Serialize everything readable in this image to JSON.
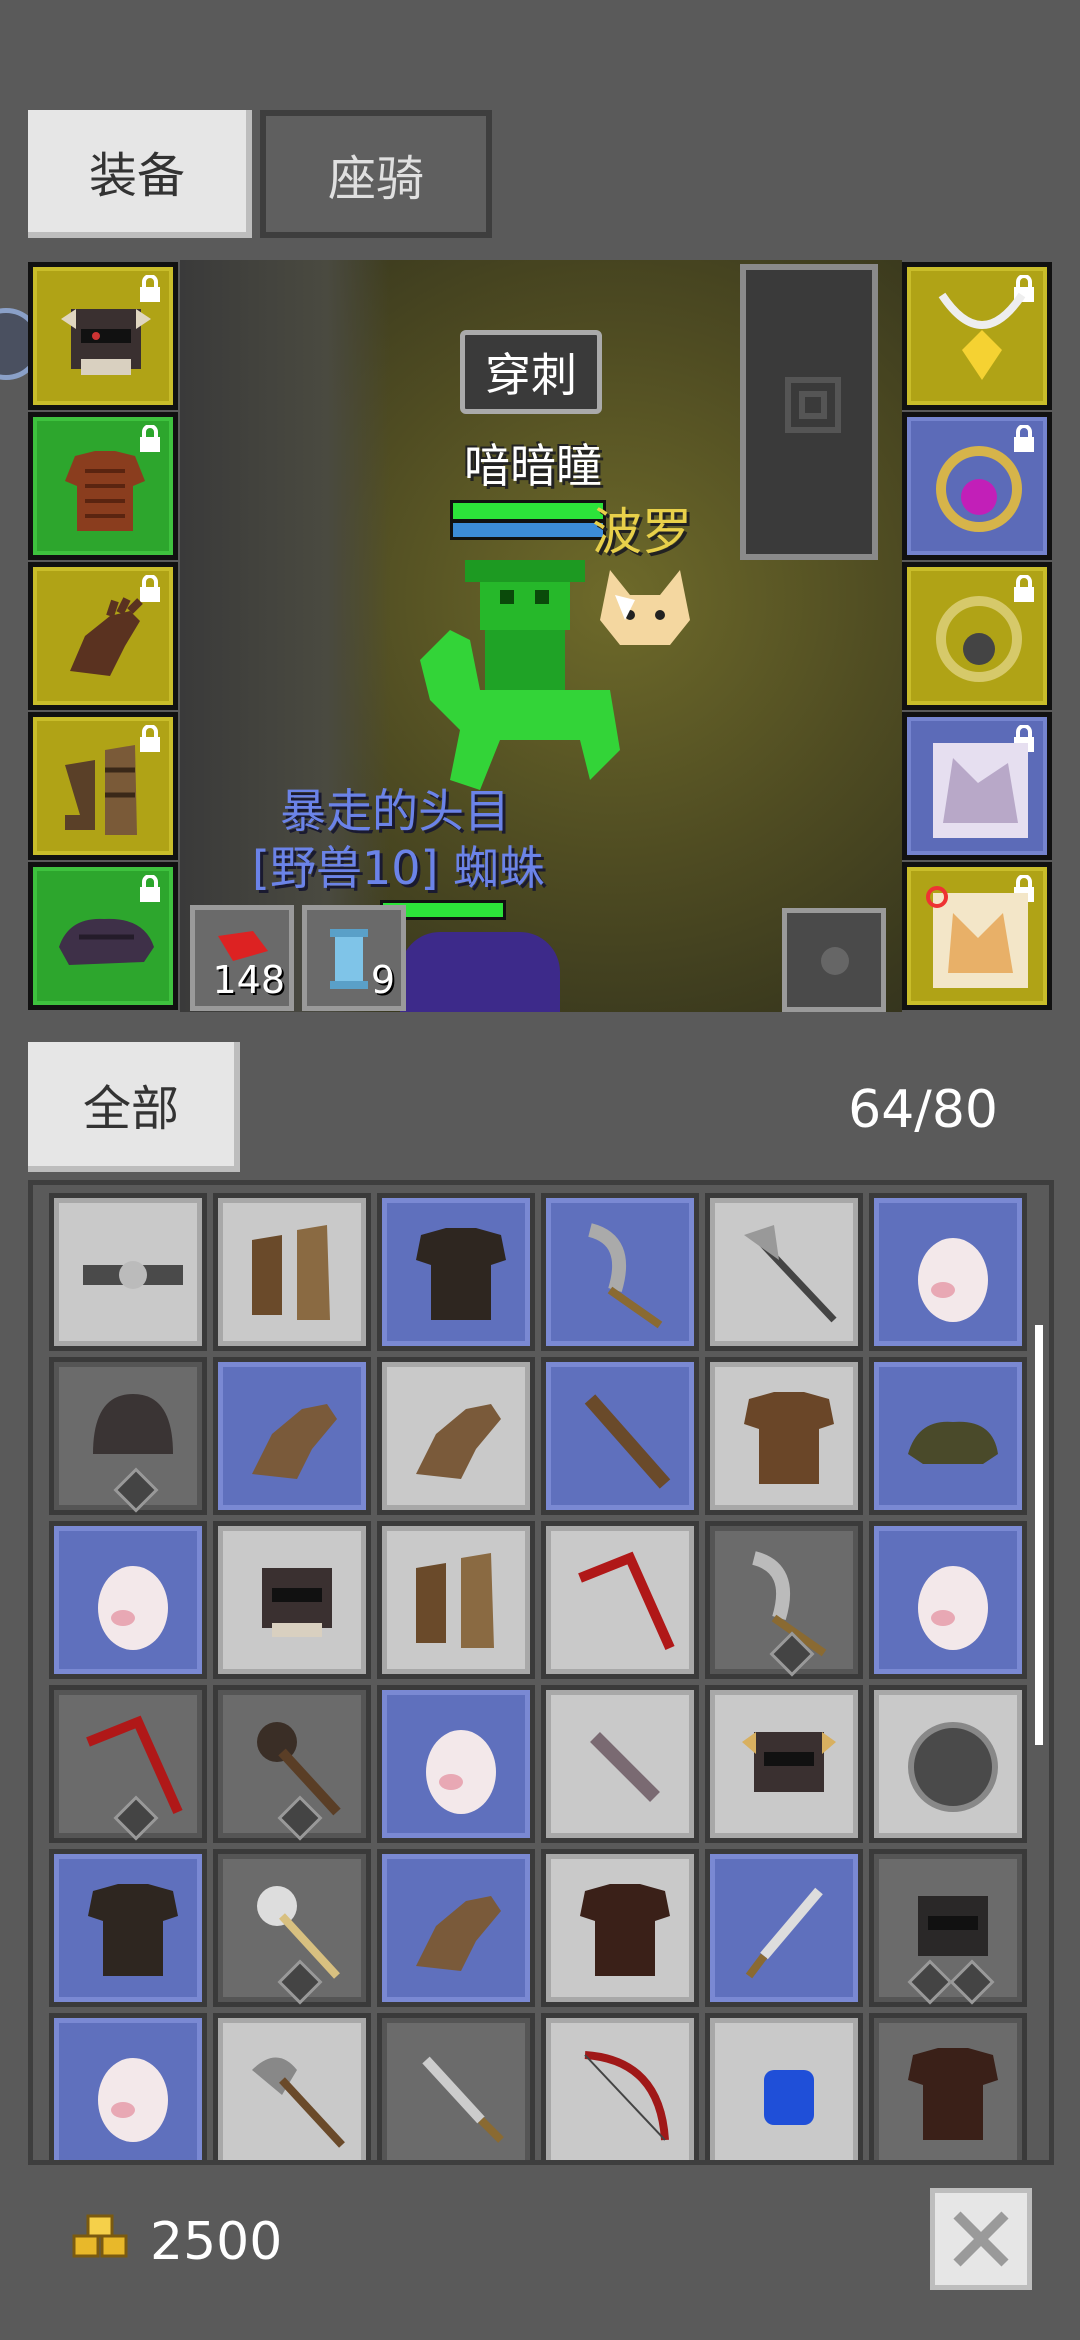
{
  "tabs": {
    "equipment": "装备",
    "mount": "座骑"
  },
  "scene": {
    "skill_bubble": "穿刺",
    "player_name": "喑暗瞳",
    "pet_name": "波罗",
    "enemy_title": "暴走的头目",
    "enemy_name": "[野兽10] 蜘蛛",
    "consumable_1_count": "148",
    "consumable_2_count": "9"
  },
  "inventory": {
    "filter_label": "全部",
    "capacity": "64/80"
  },
  "footer": {
    "gold": "2500"
  },
  "colors": {
    "slot_yellow": "#b0a316",
    "slot_green": "#2da62d",
    "slot_blue": "#5c6bb8",
    "cell_gray": "#c9c9c9",
    "cell_blue": "#5f70bd"
  },
  "icons": {
    "left_slots": [
      "helmet-icon",
      "chest-armor-icon",
      "gloves-icon",
      "boots-icon",
      "cap-icon"
    ],
    "right_slots": [
      "amulet-icon",
      "purple-ring-icon",
      "dark-ring-icon",
      "pet-card-icon",
      "pet-card-icon"
    ],
    "weapon": "pickaxe-icon",
    "close": "close-icon",
    "gold": "gold-icon"
  }
}
